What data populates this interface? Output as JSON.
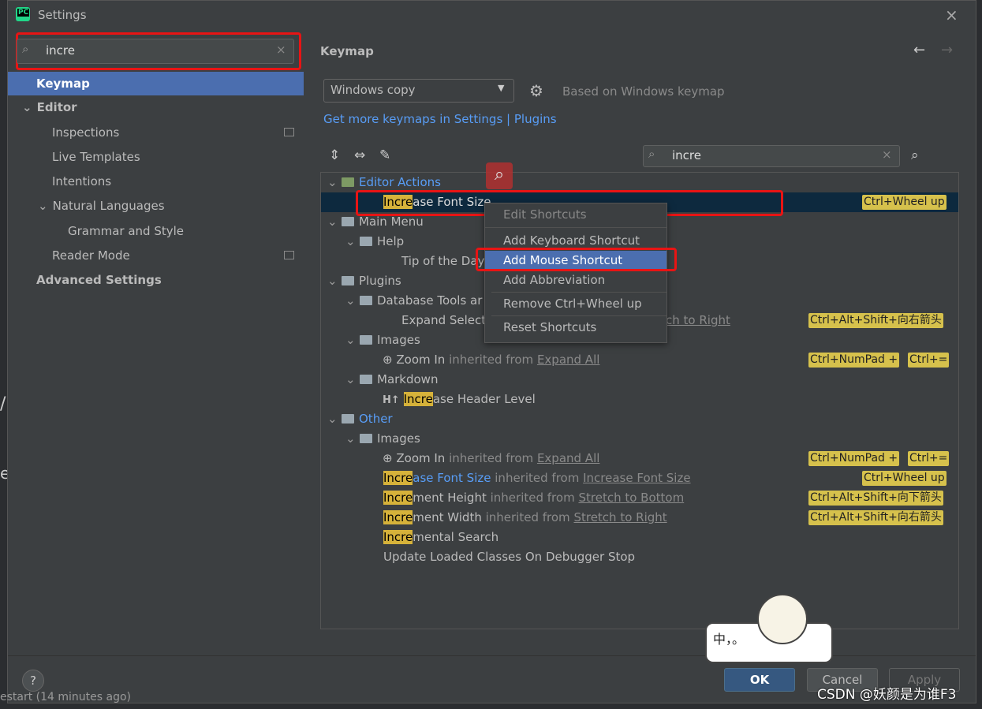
{
  "window": {
    "title": "Settings",
    "close_label": "×"
  },
  "left": {
    "search_value": "incre",
    "clear_label": "×",
    "tree": [
      {
        "label": "Keymap"
      },
      {
        "label": "Editor"
      },
      {
        "label": "Inspections"
      },
      {
        "label": "Live Templates"
      },
      {
        "label": "Intentions"
      },
      {
        "label": "Natural Languages"
      },
      {
        "label": "Grammar and Style"
      },
      {
        "label": "Reader Mode"
      },
      {
        "label": "Advanced Settings"
      }
    ]
  },
  "right": {
    "header": "Keymap",
    "keymap_select": "Windows copy",
    "based_on": "Based on Windows keymap",
    "links": {
      "keymaps": "Get more keymaps in Settings",
      "sep": "|",
      "plugins": "Plugins"
    },
    "search_value": "incre",
    "rows": {
      "editor_actions": "Editor Actions",
      "increase_font_hl": "Incre",
      "increase_font_rest": "ase Font Size",
      "increase_font_kbd": "Ctrl+Wheel up",
      "main_menu": "Main Menu",
      "help": "Help",
      "tip_of_day": "Tip of the Day",
      "plugins": "Plugins",
      "db_tools": "Database Tools ar",
      "expand_selected": "Expand Selecte",
      "expand_selected_tail": "ch to Right",
      "expand_kbd": "Ctrl+Alt+Shift+向右箭头",
      "images1": "Images",
      "zoom_in1": "Zoom In",
      "inherited_from": "inherited from",
      "expand_all": "Expand All",
      "zoom_kbd1": "Ctrl+NumPad +",
      "zoom_kbd2": "Ctrl+=",
      "markdown": "Markdown",
      "increase_header_hl": "Incre",
      "increase_header_rest": "ase Header Level",
      "other": "Other",
      "images2": "Images",
      "zoom_in2": "Zoom In",
      "inc_font_hl": "Incre",
      "inc_font_rest": "ase Font Size",
      "inc_font_src": "Increase Font Size",
      "inc_font_kbd": "Ctrl+Wheel up",
      "inc_height_hl": "Incre",
      "inc_height_rest": "ment Height",
      "inc_height_src": "Stretch to Bottom",
      "inc_height_kbd": "Ctrl+Alt+Shift+向下箭头",
      "inc_width_hl": "Incre",
      "inc_width_rest": "ment Width",
      "inc_width_src": "Stretch to Right",
      "inc_width_kbd": "Ctrl+Alt+Shift+向右箭头",
      "inc_search_hl": "Incre",
      "inc_search_rest": "mental Search",
      "update_classes": "Update Loaded Classes On Debugger Stop"
    }
  },
  "context_menu": {
    "title": "Edit Shortcuts",
    "items": [
      "Add Keyboard Shortcut",
      "Add Mouse Shortcut",
      "Add Abbreviation",
      "Remove Ctrl+Wheel up",
      "Reset Shortcuts"
    ]
  },
  "footer": {
    "help": "?",
    "ok": "OK",
    "cancel": "Cancel",
    "apply": "Apply"
  },
  "watermark": {
    "text": "CSDN @妖颜是为谁F3",
    "sticker_text": "中，。"
  },
  "background_bits": {
    "left_text": "estart (14 minutes ago)",
    "left_char1": "/",
    "left_char2": "e"
  }
}
